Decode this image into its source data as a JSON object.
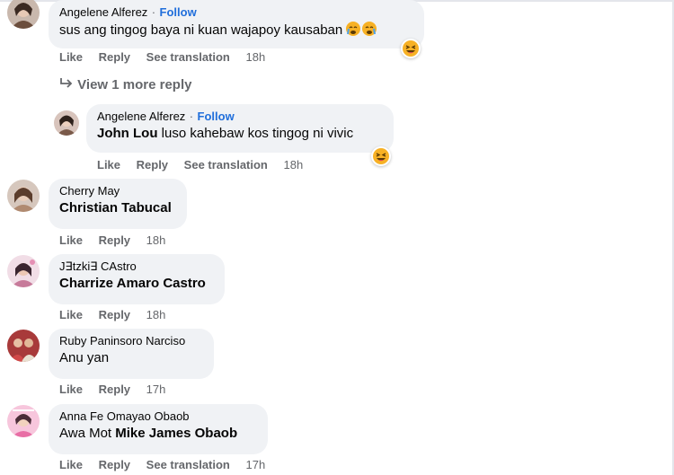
{
  "comments": [
    {
      "author": "Angelene Alferez",
      "follow": "Follow",
      "separator": "·",
      "segments": [
        {
          "text": "sus ang tingog baya ni kuan wajapoy kausaban",
          "bold": false
        }
      ],
      "actions": {
        "like": "Like",
        "reply": "Reply",
        "translate": "See translation",
        "time": "18h"
      }
    },
    {
      "author": "Angelene Alferez",
      "follow": "Follow",
      "separator": "·",
      "segments": [
        {
          "text": "John Lou",
          "bold": true
        },
        {
          "text": " luso kahebaw kos tingog ni vivic",
          "bold": false
        }
      ],
      "actions": {
        "like": "Like",
        "reply": "Reply",
        "translate": "See translation",
        "time": "18h"
      }
    },
    {
      "author": "Cherry May",
      "segments": [
        {
          "text": "Christian Tabucal",
          "bold": true
        }
      ],
      "actions": {
        "like": "Like",
        "reply": "Reply",
        "time": "18h"
      }
    },
    {
      "author": "J∃tzki∃ CAstro",
      "segments": [
        {
          "text": "Charrize Amaro Castro",
          "bold": true
        }
      ],
      "actions": {
        "like": "Like",
        "reply": "Reply",
        "time": "18h"
      }
    },
    {
      "author": "Ruby Paninsoro Narciso",
      "segments": [
        {
          "text": "Anu yan",
          "bold": false
        }
      ],
      "actions": {
        "like": "Like",
        "reply": "Reply",
        "time": "17h"
      }
    },
    {
      "author": "Anna Fe Omayao Obaob",
      "segments": [
        {
          "text": "Awa Mot ",
          "bold": false
        },
        {
          "text": "Mike James Obaob",
          "bold": true
        }
      ],
      "actions": {
        "like": "Like",
        "reply": "Reply",
        "translate": "See translation",
        "time": "17h"
      }
    }
  ],
  "view_more": {
    "label": "View 1 more reply",
    "icon": "reply-arrow-icon"
  },
  "reactions": {
    "haha_icon": "haha-reaction-icon",
    "crying_icon": "crying-emoji-icon"
  },
  "colors": {
    "bubble": "#f0f2f5",
    "follow": "#216fdb",
    "meta": "#65676b",
    "haha": "#f7b125"
  }
}
